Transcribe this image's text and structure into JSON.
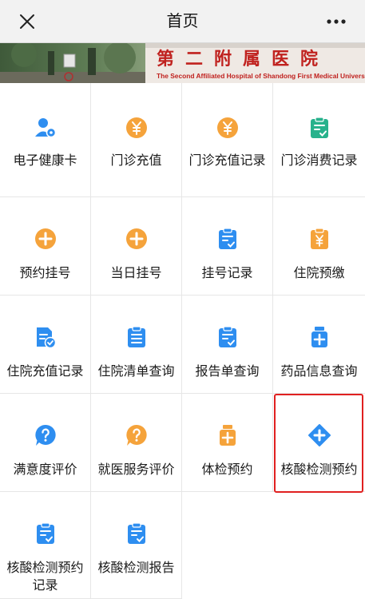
{
  "nav": {
    "title": "首页",
    "close_icon": "close-icon",
    "more_icon": "more-dots-icon"
  },
  "banner": {
    "cn_text": "第二附属医院",
    "en_text": "The Second Affiliated Hospital of Shandong First Medical University"
  },
  "colors": {
    "blue": "#2e8ef0",
    "orange": "#f5a33b",
    "teal": "#28b28c",
    "highlight": "#e02020"
  },
  "grid": {
    "items": [
      {
        "label": "电子健康卡",
        "icon": "user-card-icon"
      },
      {
        "label": "门诊充值",
        "icon": "yuan-coin-icon"
      },
      {
        "label": "门诊充值记录",
        "icon": "yuan-coin-icon"
      },
      {
        "label": "门诊消费记录",
        "icon": "clipboard-check-icon"
      },
      {
        "label": "预约挂号",
        "icon": "plus-circle-icon"
      },
      {
        "label": "当日挂号",
        "icon": "plus-circle-icon"
      },
      {
        "label": "挂号记录",
        "icon": "clipboard-check-icon"
      },
      {
        "label": "住院预缴",
        "icon": "clipboard-yuan-icon"
      },
      {
        "label": "住院充值记录",
        "icon": "document-check-icon"
      },
      {
        "label": "住院清单查询",
        "icon": "clipboard-list-icon"
      },
      {
        "label": "报告单查询",
        "icon": "clipboard-check-icon"
      },
      {
        "label": "药品信息查询",
        "icon": "medicine-bottle-icon"
      },
      {
        "label": "满意度评价",
        "icon": "question-bubble-icon"
      },
      {
        "label": "就医服务评价",
        "icon": "question-bubble-icon"
      },
      {
        "label": "体检预约",
        "icon": "medicine-bottle-icon"
      },
      {
        "label": "核酸检测预约",
        "icon": "plus-diamond-icon"
      },
      {
        "label": "核酸检测预约",
        "label2": "记录",
        "icon": "clipboard-check-icon"
      },
      {
        "label": "核酸检测报告",
        "icon": "clipboard-check-icon"
      }
    ]
  }
}
